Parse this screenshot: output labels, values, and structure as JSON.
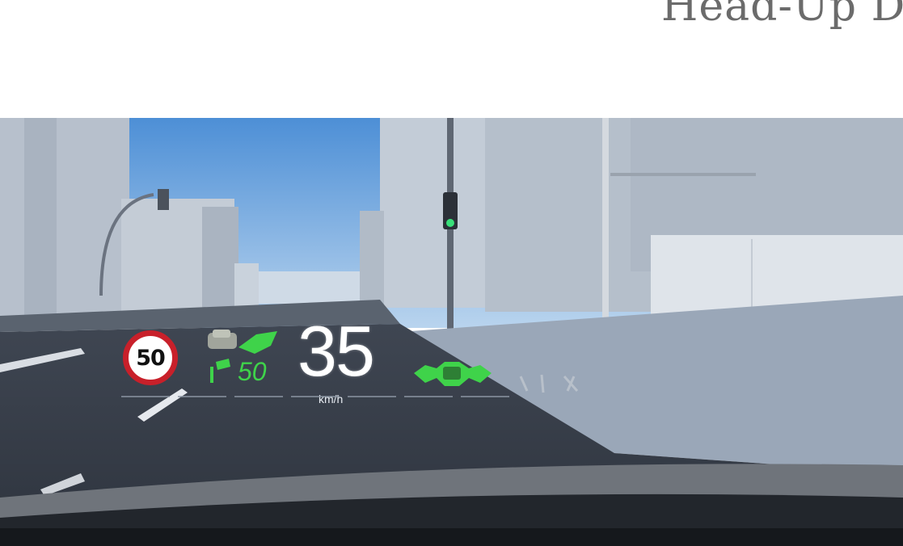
{
  "page": {
    "heading": "Head-Up D"
  },
  "hud": {
    "speed_limit": "50",
    "current_speed": "35",
    "speed_unit": "km/h",
    "acc_set_speed": "50",
    "colors": {
      "hud_green": "#3fd34a",
      "sign_red": "#c8202a",
      "hud_white": "#ffffff"
    },
    "icons": [
      "speed-limit-sign",
      "lane-assist-icon",
      "acc-car-icon",
      "lead-vehicle-icon",
      "lane-marker-icon"
    ]
  }
}
